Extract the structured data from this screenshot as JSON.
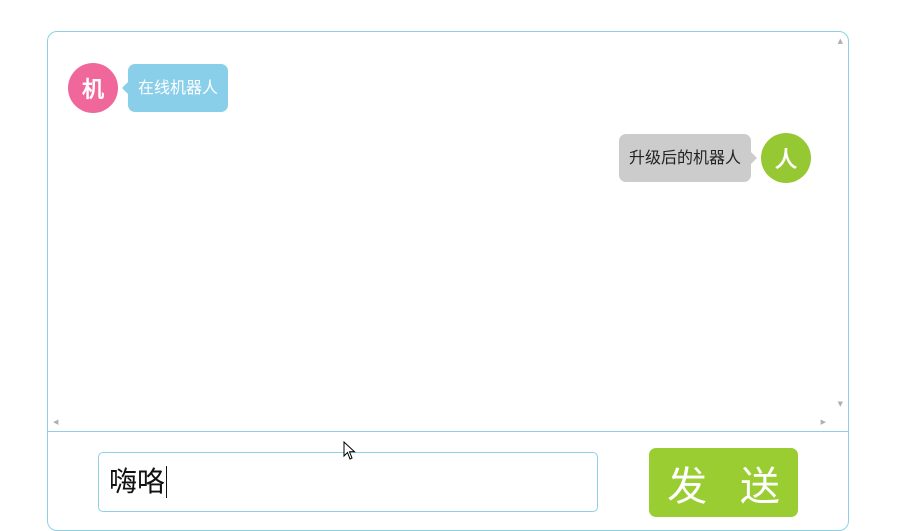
{
  "messages": [
    {
      "sender": "bot",
      "avatar_label": "机",
      "text": "在线机器人"
    },
    {
      "sender": "user",
      "avatar_label": "人",
      "text": "升级后的机器人"
    }
  ],
  "composer": {
    "input_value": "嗨咯",
    "send_label": "发 送"
  },
  "icons": {
    "scroll_up": "scroll-up-arrow-icon",
    "scroll_down": "scroll-down-arrow-icon",
    "scroll_left": "scroll-left-arrow-icon",
    "scroll_right": "scroll-right-arrow-icon",
    "pointer": "mouse-pointer-icon"
  },
  "colors": {
    "border": "#8fd0e6",
    "bot_avatar": "#f0689b",
    "bot_bubble": "#8acfea",
    "bot_bubble_text": "#ffffff",
    "user_avatar": "#96c834",
    "user_bubble": "#cccccc",
    "user_bubble_text": "#222222",
    "send_button": "#9acd32"
  }
}
